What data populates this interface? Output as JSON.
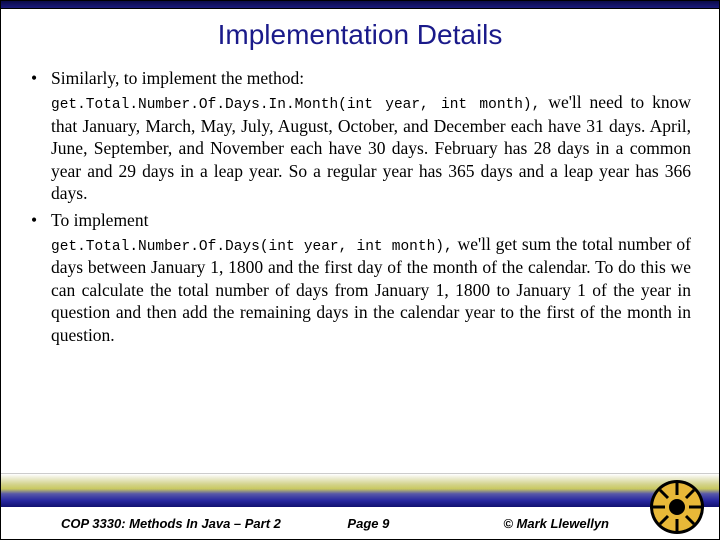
{
  "title": "Implementation Details",
  "bullets": {
    "b1": "Similarly, to implement the method:",
    "b2": "To implement"
  },
  "code1": "get.Total.Number.Of.Days.In.Month(int year, int month),",
  "para1_tail": " we'll need to know that January, March, May, July, August, October, and December each have 31 days. April, June, September, and November each have 30 days. February has 28 days in a common year and 29 days in a leap year.  So a regular year has 365 days and a leap year has 366 days.",
  "code2": "get.Total.Number.Of.Days(int year, int month),",
  "para2_tail": " we'll get sum the total number of days between January 1, 1800 and the first day of the month of the calendar.  To do this we can calculate the total number of days from January 1, 1800 to January 1 of the year in question and then add the remaining days in the calendar year to the first of the month in question.",
  "footer": {
    "course": "COP 3330: Methods In Java – Part 2",
    "page": "Page 9",
    "copyright": "© Mark Llewellyn"
  }
}
